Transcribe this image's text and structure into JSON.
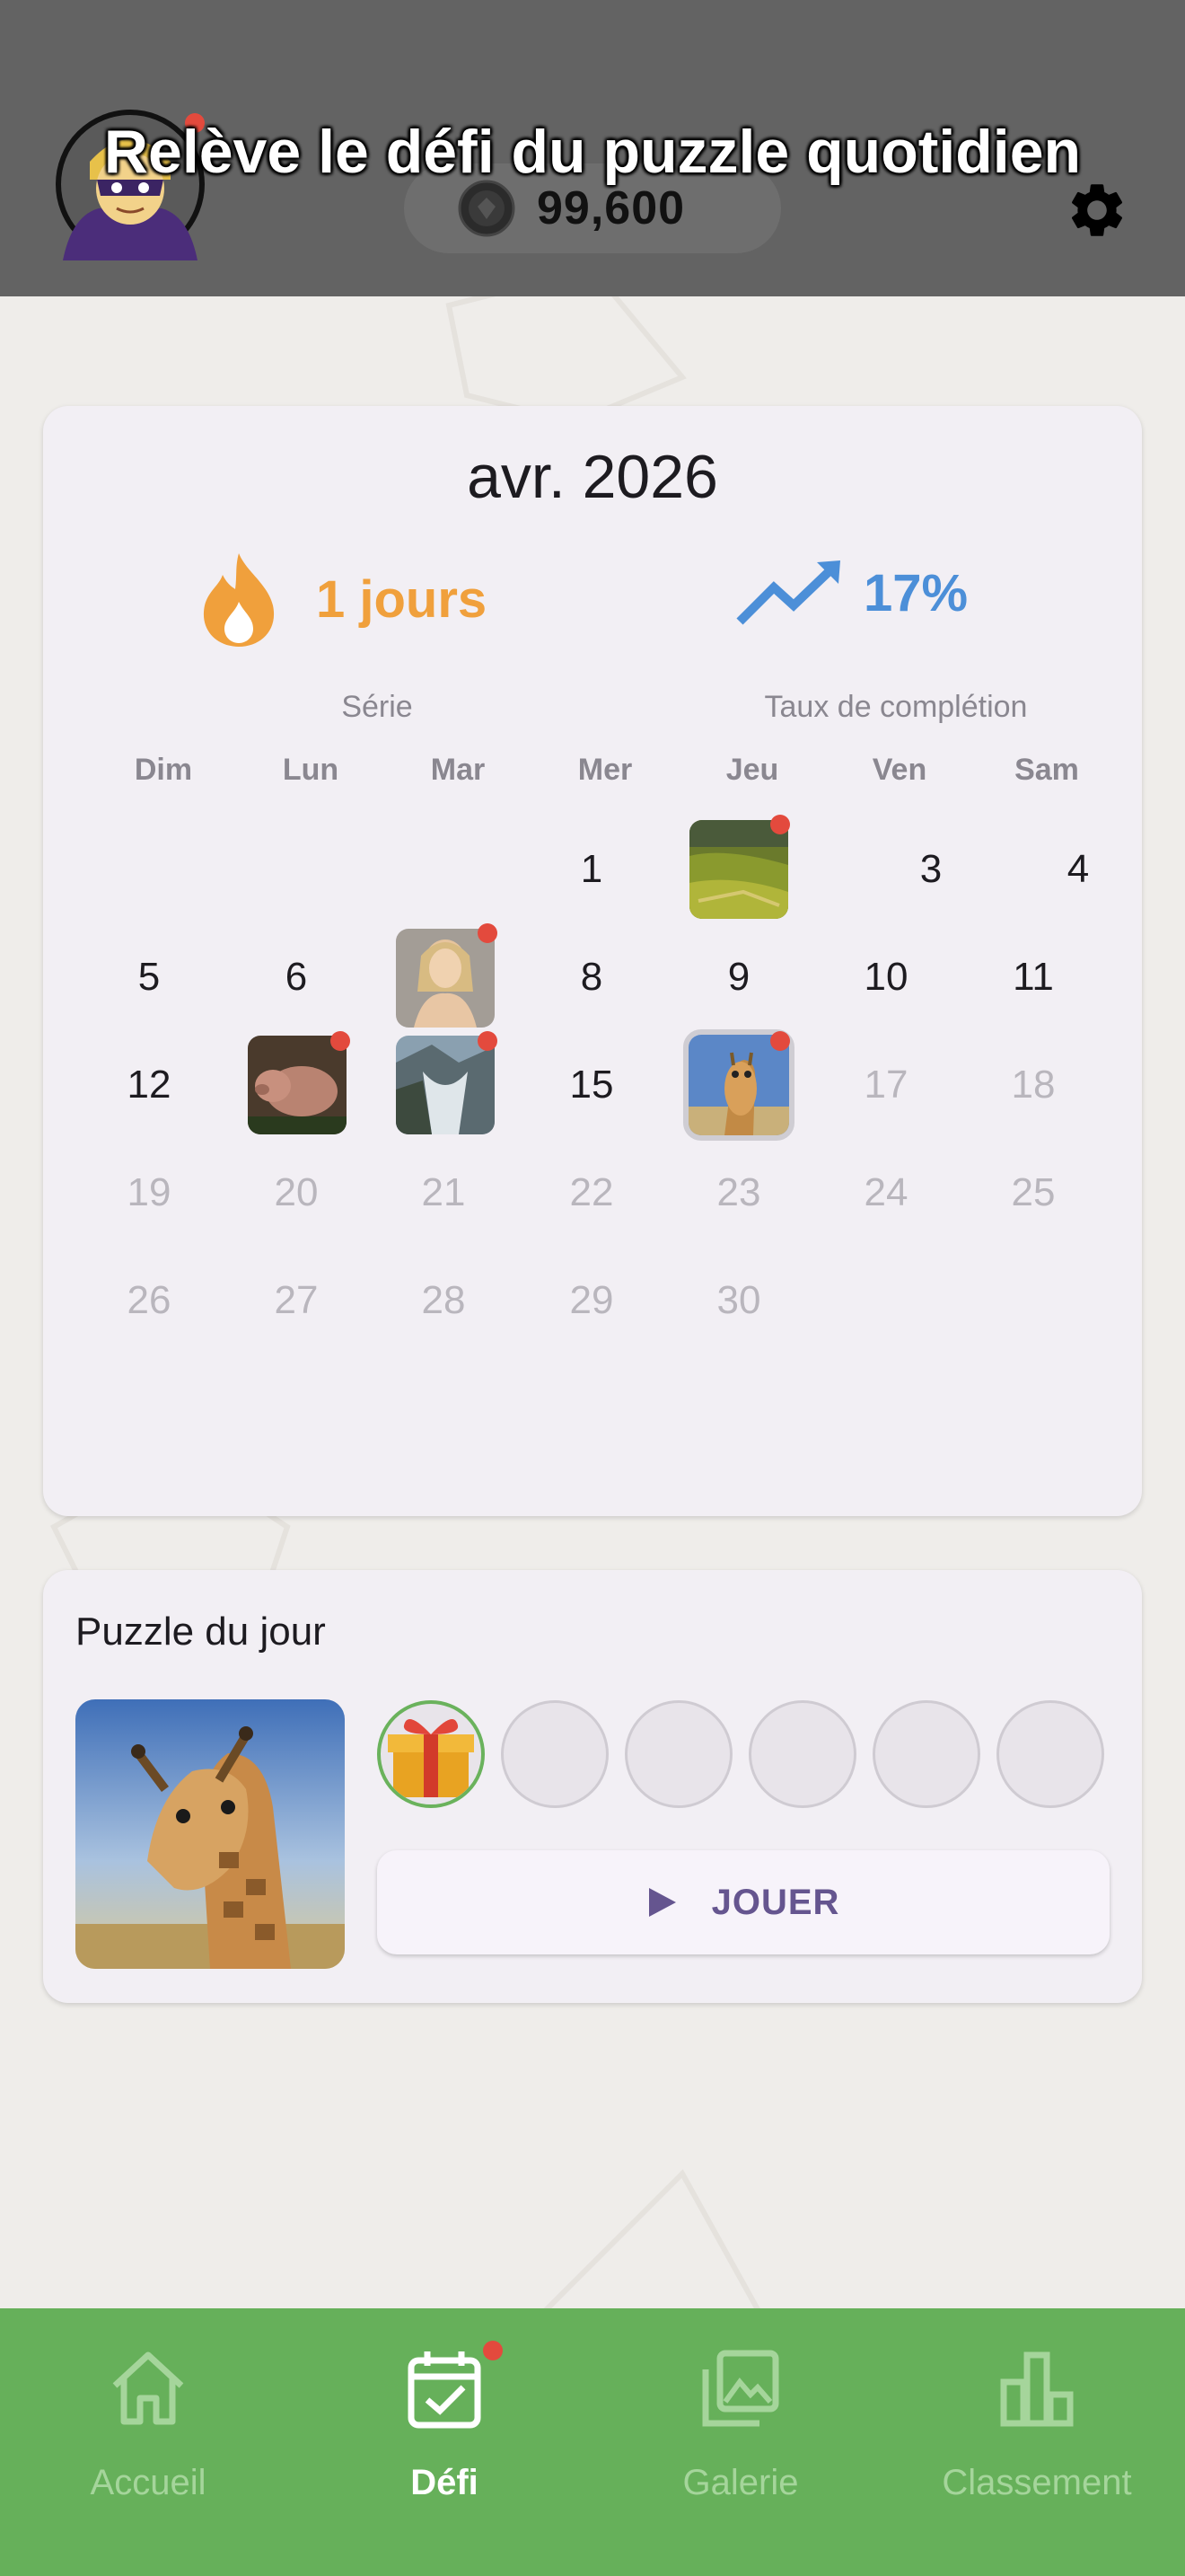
{
  "header": {
    "title": "Relève le défi du puzzle quotidien",
    "coins": "99,600",
    "avatar_icon": "hero-avatar-icon",
    "settings_icon": "gear-icon"
  },
  "calendar": {
    "month": "avr. 2026",
    "streak_value": "1 jours",
    "streak_label": "Série",
    "rate_value": "17%",
    "rate_label": "Taux de complétion",
    "weekdays": [
      "Dim",
      "Lun",
      "Mar",
      "Mer",
      "Jeu",
      "Ven",
      "Sam"
    ],
    "days": {
      "d1": "1",
      "d3": "3",
      "d4": "4",
      "d5": "5",
      "d6": "6",
      "d8": "8",
      "d9": "9",
      "d10": "10",
      "d11": "11",
      "d12": "12",
      "d15": "15",
      "d17": "17",
      "d18": "18",
      "d19": "19",
      "d20": "20",
      "d21": "21",
      "d22": "22",
      "d23": "23",
      "d24": "24",
      "d25": "25",
      "d26": "26",
      "d27": "27",
      "d28": "28",
      "d29": "29",
      "d30": "30"
    },
    "completed_days_with_thumbnail": [
      "2",
      "7",
      "13",
      "14",
      "16"
    ],
    "selected_day": "16"
  },
  "puzzle_of_day": {
    "title": "Puzzle du jour",
    "image": "giraffe-photo",
    "reward_icon": "gift-icon",
    "play_label": "JOUER"
  },
  "nav": {
    "items": [
      {
        "label": "Accueil",
        "icon": "home-icon"
      },
      {
        "label": "Défi",
        "icon": "calendar-check-icon"
      },
      {
        "label": "Galerie",
        "icon": "gallery-icon"
      },
      {
        "label": "Classement",
        "icon": "bar-chart-icon"
      }
    ],
    "active": "Défi"
  },
  "colors": {
    "header_bg": "#636363",
    "streak": "#f0a03c",
    "rate": "#4c8fd8",
    "accent": "#65558f",
    "nav_bg": "#66b05a",
    "notification": "#e34a3d"
  }
}
